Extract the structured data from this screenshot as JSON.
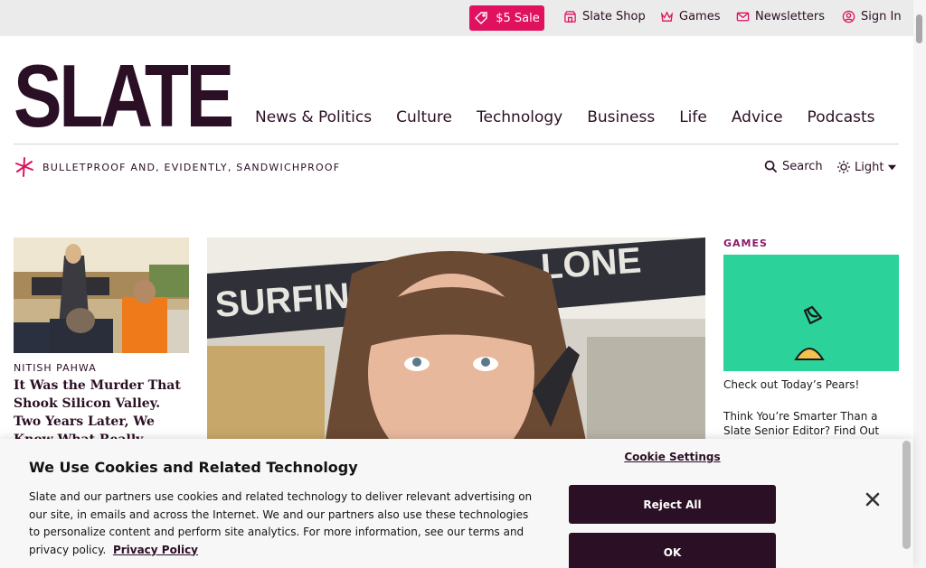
{
  "topbar": {
    "sale_label": "$5 Sale",
    "shop_label": "Slate Shop",
    "games_label": "Games",
    "newsletters_label": "Newsletters",
    "signin_label": "Sign In"
  },
  "masthead": {
    "logo_text": "SLATE",
    "nav": [
      "News & Politics",
      "Culture",
      "Technology",
      "Business",
      "Life",
      "Advice",
      "Podcasts"
    ],
    "tagline": "BULLETPROOF AND, EVIDENTLY, SANDWICHPROOF",
    "search_label": "Search",
    "theme_label": "Light"
  },
  "stories": {
    "left": {
      "byline": "NITISH PAHWA",
      "headline": "It Was the Murder That Shook Silicon Valley. Two Years Later, We Know What Really Happened."
    }
  },
  "games": {
    "section_label": "GAMES",
    "link1": "Check out Today’s Pears!",
    "link2": "Think You’re Smarter Than a Slate Senior Editor? Find Out"
  },
  "cookie": {
    "title": "We Use Cookies and Related Technology",
    "body": "Slate and our partners use cookies and related technology to deliver relevant advertising on our site, in emails and across the Internet. We and our partners also use these technologies to personalize content and perform site analytics. For more information, see our terms and privacy policy.",
    "policy_link": "Privacy Policy",
    "settings_label": "Cookie Settings",
    "reject_label": "Reject All",
    "ok_label": "OK"
  },
  "colors": {
    "brand_plum": "#2b0f24",
    "sale_pink": "#e0115f",
    "games_green": "#2bd39b"
  }
}
